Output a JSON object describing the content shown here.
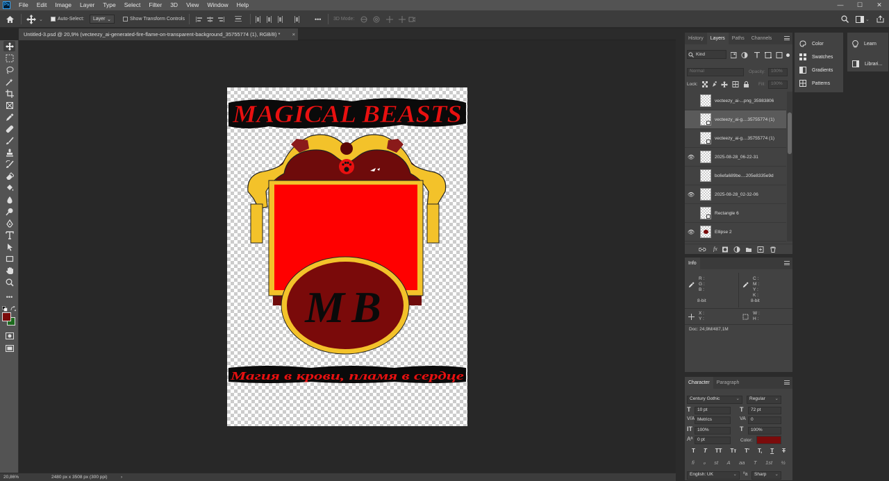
{
  "app": {
    "logo": "Ps"
  },
  "menu": [
    "File",
    "Edit",
    "Image",
    "Layer",
    "Type",
    "Select",
    "Filter",
    "3D",
    "View",
    "Window",
    "Help"
  ],
  "window_controls": {
    "minimize": "—",
    "maximize": "☐",
    "close": "✕"
  },
  "options": {
    "auto_select_label": "Auto-Select:",
    "auto_select_value": "Layer",
    "show_transform_label": "Show Transform Controls",
    "more": "•••",
    "mode_3d": "3D Mode:"
  },
  "document": {
    "tab_title": "Untitled-3.psd @ 20,9% (vecteezy_ai-generated-fire-flame-on-transparent-background_35755774 (1), RGB/8) *",
    "close": "×",
    "title_text": "MAGICAL BEASTS",
    "emblem_text": "MB",
    "slogan_text": "Магия в крови, пламя в сердце"
  },
  "status": {
    "zoom": "20,86%",
    "size": "2480 px x 3508 px (300 ppi)",
    "arrow": "›"
  },
  "colors": {
    "foreground": "#7a0b0b",
    "background": "#1e6b1e",
    "title_red": "#e81010",
    "poster_red": "#ff0000",
    "gold": "#f3c22a",
    "maroon": "#6e0b0b"
  },
  "layers_panel": {
    "tabs": [
      "History",
      "Layers",
      "Paths",
      "Channels"
    ],
    "kind_label": "Kind",
    "blend_mode": "Normal",
    "opacity_label": "Opacity:",
    "opacity_value": "100%",
    "lock_label": "Lock:",
    "fill_label": "Fill:",
    "fill_value": "100%",
    "layers": [
      {
        "name": "vecteezy_ai-...png_35983806",
        "visible": false,
        "selected": false
      },
      {
        "name": "vecteezy_ai-g....35755774 (1)",
        "visible": false,
        "selected": true
      },
      {
        "name": "vecteezy_ai-g....35755774 (1)",
        "visible": false,
        "selected": false
      },
      {
        "name": "2025-08-28_06-22-31",
        "visible": true,
        "selected": false
      },
      {
        "name": "bc6efa689be....205e8335e9d",
        "visible": false,
        "selected": false
      },
      {
        "name": "2025-08-28_02-32-06",
        "visible": true,
        "selected": false
      },
      {
        "name": "Rectangle 6",
        "visible": false,
        "selected": false
      },
      {
        "name": "Ellipse 2",
        "visible": true,
        "selected": false
      }
    ],
    "footer_fx": "fx"
  },
  "info_panel": {
    "tab": "Info",
    "rgb": [
      "R :",
      "G :",
      "B :"
    ],
    "cmyk": [
      "C :",
      "M :",
      "Y :",
      "K :"
    ],
    "bit_left": "8-bit",
    "bit_right": "8-bit",
    "xy": [
      "X :",
      "Y :"
    ],
    "wh": [
      "W :",
      "H :"
    ],
    "doc": "Doc: 24,9M/487,1M"
  },
  "character_panel": {
    "tabs": [
      "Character",
      "Paragraph"
    ],
    "font_family": "Century Gothic",
    "font_style": "Regular",
    "font_size": "10 pt",
    "leading": "72 pt",
    "kerning": "Metrics",
    "tracking": "0",
    "vscale": "100%",
    "hscale": "100%",
    "baseline": "0 pt",
    "color_label": "Color:",
    "color_value": "#7a0b0b",
    "style_buttons": [
      "T",
      "T",
      "TT",
      "Tт",
      "T'",
      "T,",
      "T",
      "T"
    ],
    "opentype_buttons": [
      "fi",
      "ℴ",
      "st",
      "A",
      "aa",
      "T",
      "1st",
      "½"
    ],
    "language": "English: UK",
    "antialias": "Sharp"
  },
  "dock": {
    "items": [
      "Color",
      "Swatches",
      "Gradients",
      "Patterns"
    ],
    "learn": "Learn",
    "libraries": "Librari..."
  }
}
